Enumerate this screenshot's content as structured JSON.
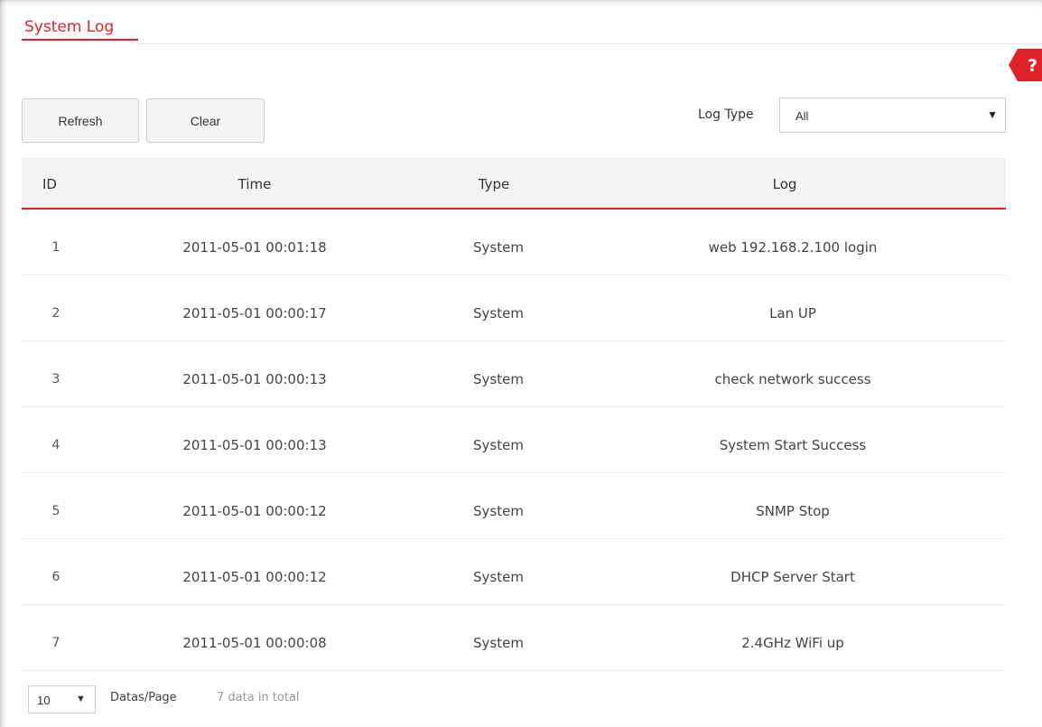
{
  "page": {
    "title": "System Log"
  },
  "toolbar": {
    "refresh_label": "Refresh",
    "clear_label": "Clear",
    "log_type_label": "Log Type",
    "log_type_value": "All"
  },
  "table": {
    "columns": [
      "ID",
      "Time",
      "Type",
      "Log"
    ],
    "rows": [
      {
        "id": "1",
        "time": "2011-05-01 00:01:18",
        "type": "System",
        "log": "web 192.168.2.100 login"
      },
      {
        "id": "2",
        "time": "2011-05-01 00:00:17",
        "type": "System",
        "log": "Lan UP"
      },
      {
        "id": "3",
        "time": "2011-05-01 00:00:13",
        "type": "System",
        "log": "check network success"
      },
      {
        "id": "4",
        "time": "2011-05-01 00:00:13",
        "type": "System",
        "log": "System Start Success"
      },
      {
        "id": "5",
        "time": "2011-05-01 00:00:12",
        "type": "System",
        "log": "SNMP Stop"
      },
      {
        "id": "6",
        "time": "2011-05-01 00:00:12",
        "type": "System",
        "log": "DHCP Server Start"
      },
      {
        "id": "7",
        "time": "2011-05-01 00:00:08",
        "type": "System",
        "log": "2.4GHz WiFi up"
      }
    ]
  },
  "pagination": {
    "per_page_value": "10",
    "per_page_label": "Datas/Page",
    "total_text": "7 data in total"
  },
  "help": {
    "label": "?"
  },
  "colors": {
    "accent": "#e0232b",
    "header_bg": "#f4f4f4",
    "button_bg": "#f5f5f5"
  },
  "icons": {
    "dropdown": "triangle-down",
    "help": "question-mark-badge"
  }
}
